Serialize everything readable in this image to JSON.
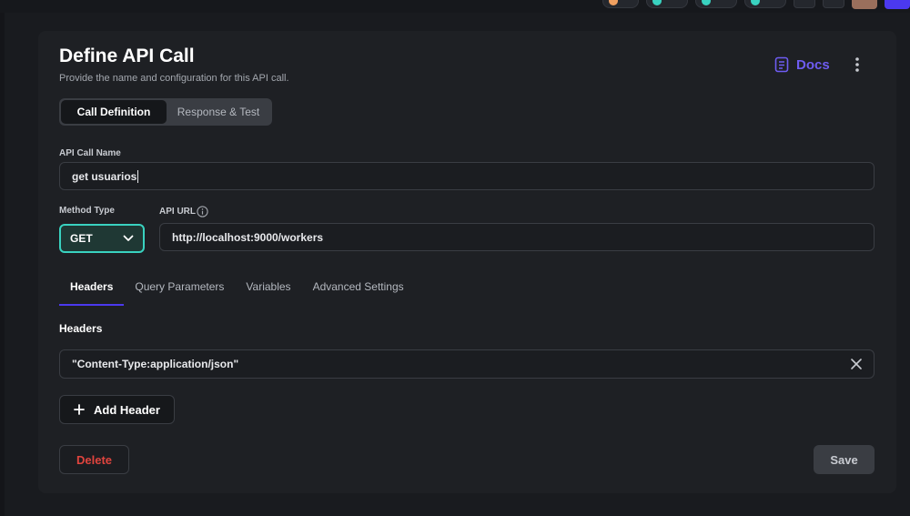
{
  "colors": {
    "accent": "#4b39ef",
    "teal": "#39d2c0",
    "danger": "#e0443e",
    "background": "#191b1f",
    "panel": "#1e2024"
  },
  "dialog": {
    "title": "Define API Call",
    "subtitle": "Provide the name and configuration for this API call.",
    "docs_label": "Docs",
    "docs_icon": "document-icon",
    "more_icon": "more-vertical-icon"
  },
  "mode_tabs": [
    {
      "label": "Call Definition",
      "active": true
    },
    {
      "label": "Response & Test",
      "active": false
    }
  ],
  "form": {
    "api_call_name_label": "API Call Name",
    "api_call_name_value": "get usuarios",
    "method_type_label": "Method Type",
    "method_value": "GET",
    "api_url_label": "API URL",
    "api_url_value": "http://localhost:9000/workers"
  },
  "config_tabs": [
    {
      "label": "Headers",
      "active": true
    },
    {
      "label": "Query Parameters",
      "active": false
    },
    {
      "label": "Variables",
      "active": false
    },
    {
      "label": "Advanced Settings",
      "active": false
    }
  ],
  "headers_section": {
    "title": "Headers",
    "items": [
      {
        "value": "\"Content-Type:application/json\""
      }
    ],
    "add_label": "Add Header"
  },
  "footer": {
    "delete_label": "Delete",
    "save_label": "Save"
  }
}
